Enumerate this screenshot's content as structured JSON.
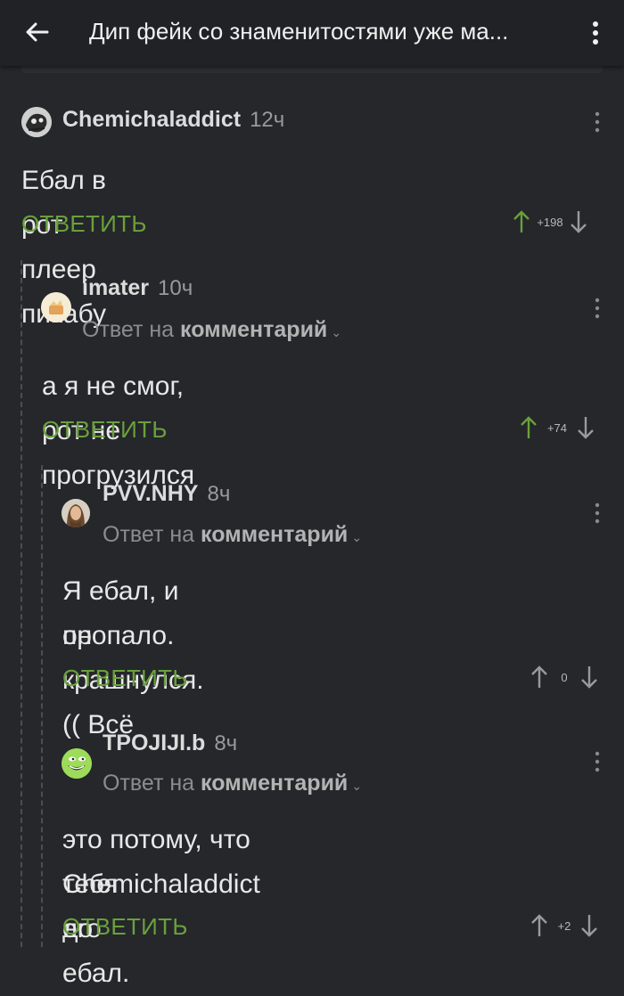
{
  "header": {
    "title": "Дип фейк со знаменитостями уже ма..."
  },
  "comments": [
    {
      "user": "Chemichaladdict",
      "time": "12ч",
      "text": "Ебал в рот плеер пикабу",
      "reply_label": "ОТВЕТИТЬ",
      "score": "+198"
    },
    {
      "user": "imater",
      "time": "10ч",
      "reply_prefix": "Ответ на",
      "reply_target": "комментарий",
      "text": "а я не смог, рот не прогрузился",
      "reply_label": "ОТВЕТИТЬ",
      "score": "+74"
    },
    {
      "user": "PVV.NHY",
      "time": "8ч",
      "reply_prefix": "Ответ на",
      "reply_target": "комментарий",
      "text_lines": [
        "Я ебал, и он крашнулся. (( Всё",
        "пропало."
      ],
      "reply_label": "ОТВЕТИТЬ",
      "score": "0"
    },
    {
      "user": "TPOJIJI.b",
      "time": "8ч",
      "reply_prefix": "Ответ на",
      "reply_target": "комментарий",
      "text_lines": [
        "это потому, что Chemichaladdict до",
        "тебя его ебал."
      ],
      "reply_label": "ОТВЕТИТЬ",
      "score": "+2"
    }
  ],
  "colors": {
    "background": "#25272b",
    "topbar": "#202226",
    "accent_green": "#6aa03c",
    "thread_line": "#4a4d52"
  },
  "icons": [
    "back-arrow-icon",
    "more-vert-icon",
    "arrow-up-icon",
    "arrow-down-icon",
    "chevron-down-icon"
  ]
}
